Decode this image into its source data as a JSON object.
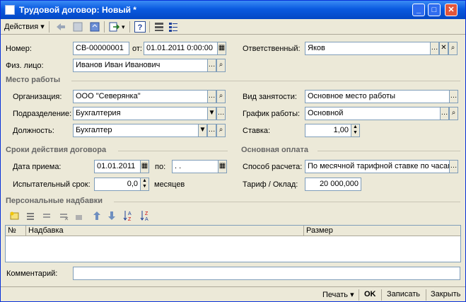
{
  "window": {
    "title": "Трудовой договор: Новый *"
  },
  "toolbar": {
    "actions_label": "Действия",
    "help_icon": "?"
  },
  "form": {
    "number_label": "Номер:",
    "number_value": "СВ-00000001",
    "from_label": "от:",
    "from_value": "01.01.2011  0:00:00",
    "responsible_label": "Ответственный:",
    "responsible_value": "Яков",
    "person_label": "Физ. лицо:",
    "person_value": "Иванов Иван Иванович"
  },
  "workplace": {
    "section_title": "Место работы",
    "org_label": "Организация:",
    "org_value": "ООО \"Северянка\"",
    "dept_label": "Подразделение:",
    "dept_value": "Бухгалтерия",
    "position_label": "Должность:",
    "position_value": "Бухгалтер",
    "employment_label": "Вид занятости:",
    "employment_value": "Основное место работы",
    "schedule_label": "График работы:",
    "schedule_value": "Основной",
    "rate_label": "Ставка:",
    "rate_value": "1,00"
  },
  "term": {
    "section_title": "Сроки действия договора",
    "hire_label": "Дата приема:",
    "hire_value": "01.01.2011",
    "to_label": "по:",
    "to_value": " .  .",
    "probation_label": "Испытательный срок:",
    "probation_value": "0,0",
    "months_label": "месяцев"
  },
  "pay": {
    "section_title": "Основная оплата",
    "method_label": "Способ расчета:",
    "method_value": "По месячной тарифной ставке по часам",
    "tariff_label": "Тариф / Оклад:",
    "tariff_value": "20 000,000"
  },
  "allowances": {
    "section_title": "Персональные надбавки",
    "columns": [
      "№",
      "Надбавка",
      "Размер"
    ]
  },
  "comment": {
    "label": "Комментарий:",
    "value": ""
  },
  "statusbar": {
    "print_label": "Печать",
    "ok_label": "OK",
    "save_label": "Записать",
    "close_label": "Закрыть"
  }
}
